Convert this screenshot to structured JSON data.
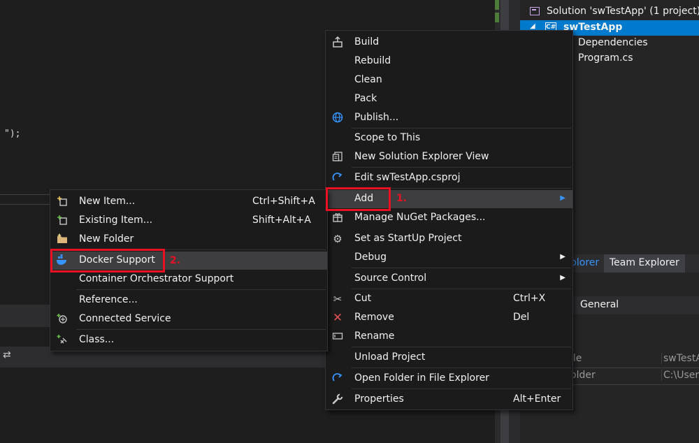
{
  "code_editor": {
    "visible_text": "\");"
  },
  "solution_explorer": {
    "solution_label": "Solution 'swTestApp' (1 project)",
    "project_label": "swTestApp",
    "items": [
      "Dependencies",
      "Program.cs"
    ],
    "tab_active": "plorer",
    "tab_inactive": "Team Explorer"
  },
  "properties": {
    "section_label": "General",
    "rows": [
      {
        "key": "ile",
        "value": "swTestA"
      },
      {
        "key": "older",
        "value": "C:\\Users\\"
      }
    ]
  },
  "project_menu": {
    "items": [
      {
        "label": "Build",
        "icon": "build-icon"
      },
      {
        "label": "Rebuild"
      },
      {
        "label": "Clean"
      },
      {
        "label": "Pack"
      },
      {
        "label": "Publish...",
        "icon": "globe-icon"
      },
      {
        "label": "Scope to This"
      },
      {
        "label": "New Solution Explorer View",
        "icon": "new-view-icon"
      },
      {
        "label": "Edit swTestApp.csproj",
        "icon": "refresh-arrow-icon"
      },
      {
        "label": "Add",
        "submenu": true,
        "highlighted": true
      },
      {
        "label": "Manage NuGet Packages...",
        "icon": "nuget-icon"
      },
      {
        "label": "Set as StartUp Project",
        "icon": "gear-icon"
      },
      {
        "label": "Debug",
        "submenu": true
      },
      {
        "label": "Source Control",
        "submenu": true
      },
      {
        "label": "Cut",
        "shortcut": "Ctrl+X",
        "icon": "scissors-icon"
      },
      {
        "label": "Remove",
        "shortcut": "Del",
        "icon": "close-icon"
      },
      {
        "label": "Rename",
        "icon": "rename-icon"
      },
      {
        "label": "Unload Project"
      },
      {
        "label": "Open Folder in File Explorer",
        "icon": "refresh-arrow-icon"
      },
      {
        "label": "Properties",
        "shortcut": "Alt+Enter",
        "icon": "wrench-icon"
      }
    ]
  },
  "add_submenu": {
    "items": [
      {
        "label": "New Item...",
        "shortcut": "Ctrl+Shift+A",
        "icon": "new-item-icon"
      },
      {
        "label": "Existing Item...",
        "shortcut": "Shift+Alt+A",
        "icon": "existing-item-icon"
      },
      {
        "label": "New Folder",
        "icon": "folder-icon"
      },
      {
        "label": "Docker Support",
        "icon": "docker-icon",
        "highlighted": true
      },
      {
        "label": "Container Orchestrator Support"
      },
      {
        "label": "Reference..."
      },
      {
        "label": "Connected Service",
        "icon": "connected-service-icon"
      },
      {
        "label": "Class...",
        "icon": "class-icon"
      }
    ]
  },
  "annotations": {
    "step1": "1.",
    "step2": "2."
  },
  "colors": {
    "accent": "#007acc",
    "callout": "#e81123",
    "menu_bg": "#1b1b1c",
    "hover_bg": "#3e3e40"
  }
}
